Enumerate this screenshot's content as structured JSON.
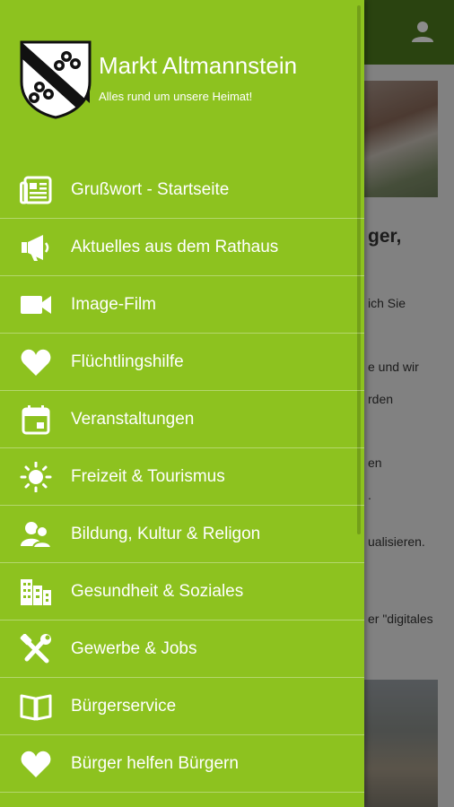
{
  "colors": {
    "drawer": "#8dc21f",
    "appbar": "#4d7a1e"
  },
  "header": {
    "town": "Markt Altmannstein",
    "tagline": "Alles rund um unsere Heimat!"
  },
  "menu": [
    {
      "label": "Grußwort - Startseite",
      "icon": "newspaper-icon"
    },
    {
      "label": "Aktuelles aus dem Rathaus",
      "icon": "megaphone-icon"
    },
    {
      "label": "Image-Film",
      "icon": "video-camera-icon"
    },
    {
      "label": "Flüchtlingshilfe",
      "icon": "heart-icon"
    },
    {
      "label": "Veranstaltungen",
      "icon": "calendar-icon"
    },
    {
      "label": "Freizeit & Tourismus",
      "icon": "sun-icon"
    },
    {
      "label": "Bildung, Kultur & Religon",
      "icon": "people-icon"
    },
    {
      "label": "Gesundheit & Soziales",
      "icon": "buildings-icon"
    },
    {
      "label": "Gewerbe & Jobs",
      "icon": "tools-icon"
    },
    {
      "label": "Bürgerservice",
      "icon": "book-icon"
    },
    {
      "label": "Bürger helfen Bürgern",
      "icon": "heart-icon"
    }
  ],
  "background": {
    "lines": [
      "ger,",
      "ich Sie",
      "e und wir",
      "rden",
      "en",
      ".",
      "ualisieren.",
      "er \"digitales"
    ]
  }
}
